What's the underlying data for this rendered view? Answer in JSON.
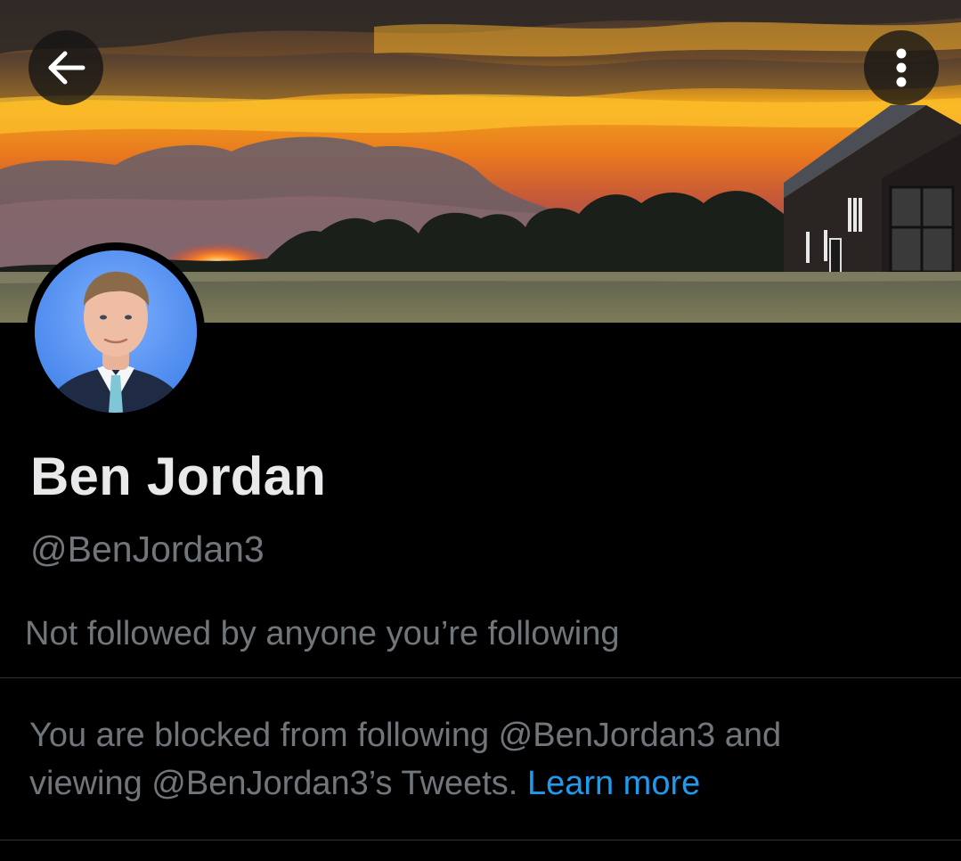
{
  "header": {
    "back_icon": "arrow-left-icon",
    "more_icon": "vertical-ellipsis-icon"
  },
  "profile": {
    "display_name": "Ben Jordan",
    "handle": "@BenJordan3",
    "followed_by": "Not followed by anyone you’re following"
  },
  "blocked_notice": {
    "line1": "You are blocked from following @BenJordan3 and",
    "line2_text": "viewing @BenJordan3’s Tweets. ",
    "learn_more": "Learn more"
  },
  "colors": {
    "background": "#000000",
    "primary_text": "#e7e9ea",
    "secondary_text": "#71767b",
    "link": "#1d9bf0",
    "divider": "#2f3336"
  }
}
